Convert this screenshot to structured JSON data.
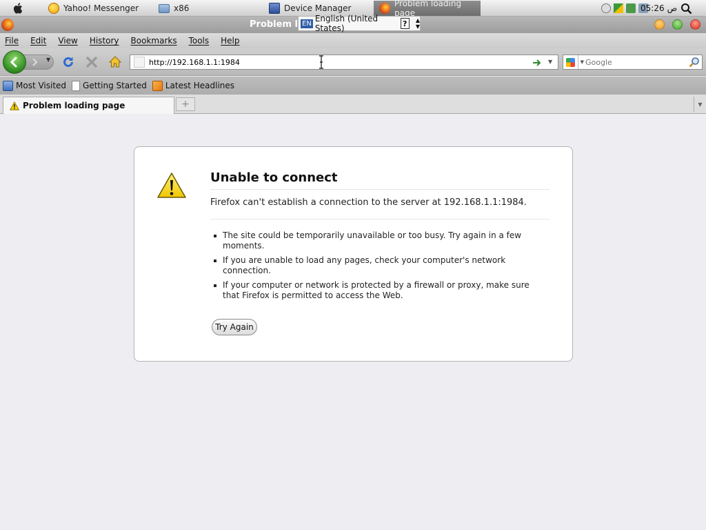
{
  "system_panel": {
    "tasks": [
      {
        "label": "Yahoo! Messenger",
        "icon": "yahoo-messenger-icon"
      },
      {
        "label": "x86",
        "icon": "folder-icon"
      },
      {
        "label": "Device Manager",
        "icon": "device-manager-icon"
      },
      {
        "label": "Problem loading page",
        "icon": "firefox-icon"
      }
    ],
    "clock": "05:26",
    "clock_suffix": "ص"
  },
  "window": {
    "title": "Problem l",
    "language_popup": {
      "code": "EN",
      "label": "English (United States)",
      "help": "?"
    }
  },
  "menu": [
    "File",
    "Edit",
    "View",
    "History",
    "Bookmarks",
    "Tools",
    "Help"
  ],
  "navbar": {
    "url": "http://192.168.1.1:1984",
    "search_placeholder": "Google"
  },
  "bookmarks": [
    {
      "label": "Most Visited",
      "icon": "most-visited-icon"
    },
    {
      "label": "Getting Started",
      "icon": "page-icon"
    },
    {
      "label": "Latest Headlines",
      "icon": "rss-icon"
    }
  ],
  "tabs": [
    {
      "label": "Problem loading page",
      "icon": "warning-icon"
    }
  ],
  "error_page": {
    "title": "Unable to connect",
    "description": "Firefox can't establish a connection to the server at 192.168.1.1:1984.",
    "items": [
      "The site could be temporarily unavailable or too busy. Try again in a few moments.",
      "If you are unable to load any pages, check your computer's network connection.",
      "If your computer or network is protected by a firewall or proxy, make sure that Firefox is permitted to access the Web."
    ],
    "button": "Try Again"
  },
  "colors": {
    "accent_green": "#2d8a1e",
    "warning_yellow": "#f5d000",
    "page_background": "#eeedf2"
  }
}
